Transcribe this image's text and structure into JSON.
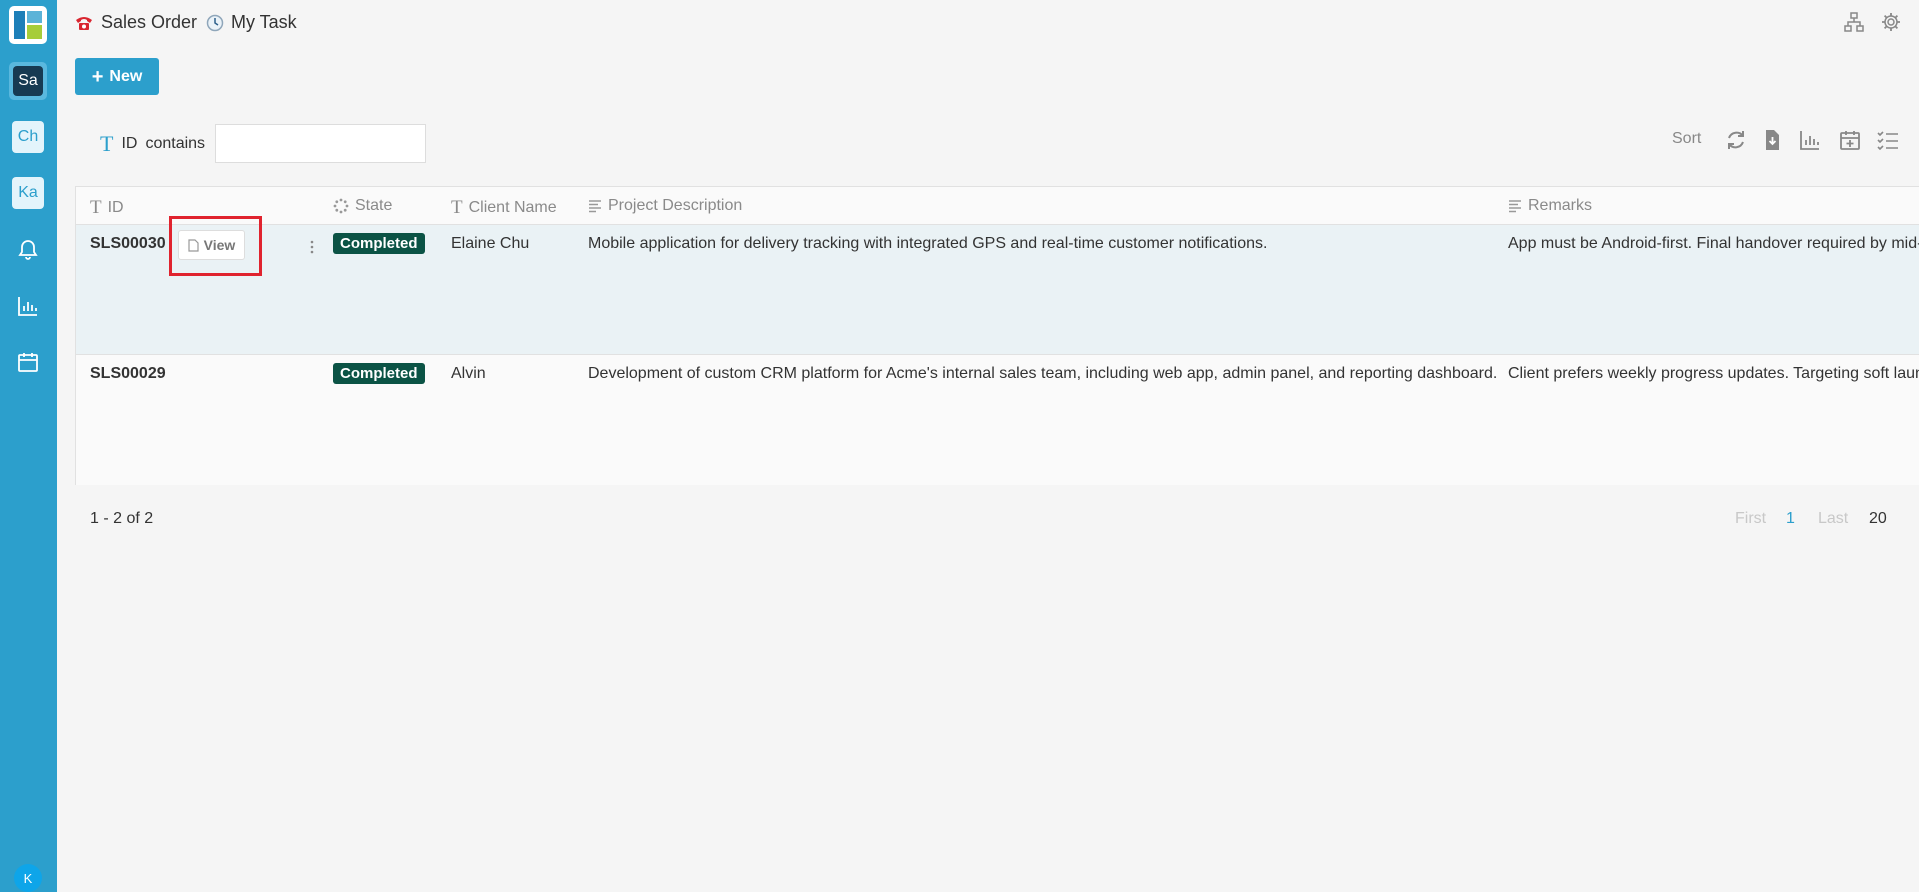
{
  "sidebar": {
    "apps": [
      {
        "label": "Sa",
        "active": true
      },
      {
        "label": "Ch",
        "active": false
      },
      {
        "label": "Ka",
        "active": false
      }
    ],
    "icons": [
      "bell-icon",
      "chart-icon",
      "calendar-icon"
    ],
    "user_initial": "K",
    "color": "#2c9fcc"
  },
  "header": {
    "breadcrumb": [
      {
        "label": "Sales Order",
        "icon": "phone-icon"
      },
      {
        "label": "My Task",
        "icon": "clock-icon"
      }
    ],
    "right_icons": [
      "sitemap-icon",
      "gear-icon"
    ]
  },
  "toolbar": {
    "new_label": "New"
  },
  "filter": {
    "field": "ID",
    "operator": "contains",
    "value": ""
  },
  "view_tools": {
    "sort_label": "Sort",
    "icons": [
      "refresh-icon",
      "export-icon",
      "chart-icon",
      "calendar-add-icon",
      "checklist-icon"
    ]
  },
  "table": {
    "columns": [
      {
        "label": "ID",
        "icon": "text-icon"
      },
      {
        "label": "State",
        "icon": "spinner-icon"
      },
      {
        "label": "Client Name",
        "icon": "text-icon"
      },
      {
        "label": "Project Description",
        "icon": "paragraph-icon"
      },
      {
        "label": "Remarks",
        "icon": "paragraph-icon"
      }
    ],
    "rows": [
      {
        "id": "SLS00030",
        "state": "Completed",
        "client": "Elaine Chu",
        "description": "Mobile application for delivery tracking with integrated GPS and real-time customer notifications.",
        "remarks": "App must be Android-first. Final handover required by mid-S",
        "view_label": "View"
      },
      {
        "id": "SLS00029",
        "state": "Completed",
        "client": "Alvin",
        "description": "Development of custom CRM platform for Acme's internal sales team, including web app, admin panel, and reporting dashboard.",
        "remarks": "Client prefers weekly progress updates. Targeting soft launc"
      }
    ],
    "state_color": "#0b5345"
  },
  "pagination": {
    "summary": "1 - 2 of 2",
    "first": "First",
    "current": "1",
    "last": "Last",
    "page_size": "20"
  }
}
